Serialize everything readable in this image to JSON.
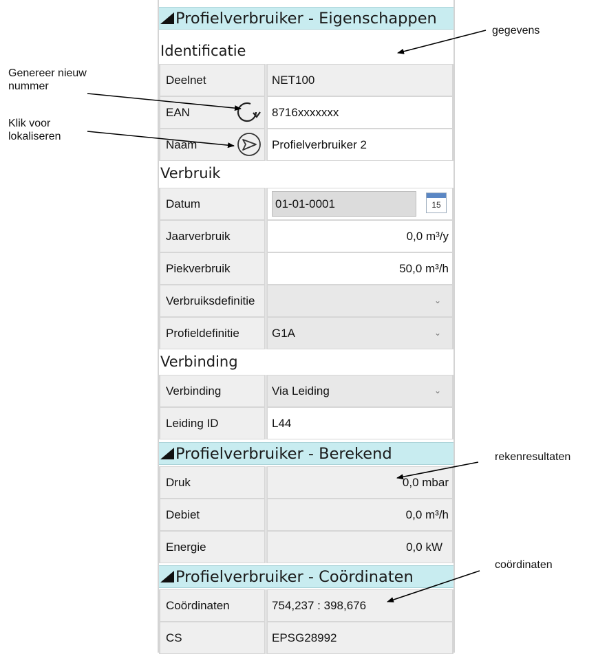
{
  "sections": {
    "eigenschappen": "Profielverbruiker - Eigenschappen",
    "berekend": "Profielverbruiker - Berekend",
    "coordinaten": "Profielverbruiker - Coördinaten"
  },
  "groups": {
    "identificatie": "Identificatie",
    "verbruik": "Verbruik",
    "verbinding": "Verbinding"
  },
  "identificatie": {
    "deelnet": {
      "label": "Deelnet",
      "value": "NET100"
    },
    "ean": {
      "label": "EAN",
      "value": "8716xxxxxxx"
    },
    "naam": {
      "label": "Naam",
      "value": "Profielverbruiker 2"
    }
  },
  "verbruik": {
    "datum": {
      "label": "Datum",
      "value": "01-01-0001",
      "calendar_day": "15"
    },
    "jaarverbruik": {
      "label": "Jaarverbruik",
      "value": "0,0 m³/y"
    },
    "piekverbruik": {
      "label": "Piekverbruik",
      "value": "50,0 m³/h"
    },
    "verbruiksdefinitie": {
      "label": "Verbruiksdefinitie",
      "value": ""
    },
    "profieldefinitie": {
      "label": "Profieldefinitie",
      "value": "G1A"
    }
  },
  "verbinding": {
    "verbinding": {
      "label": "Verbinding",
      "value": "Via Leiding"
    },
    "leiding_id": {
      "label": "Leiding ID",
      "value": "L44"
    }
  },
  "berekend": {
    "druk": {
      "label": "Druk",
      "value": "0,0 mbar"
    },
    "debiet": {
      "label": "Debiet",
      "value": "0,0 m³/h"
    },
    "energie": {
      "label": "Energie",
      "value": "0,0 kW"
    }
  },
  "coordinaten": {
    "coordinaten": {
      "label": "Coördinaten",
      "value": "754,237 : 398,676"
    },
    "cs": {
      "label": "CS",
      "value": "EPSG28992"
    }
  },
  "annotations": {
    "gegevens": "gegevens",
    "genereer_line1": "Genereer nieuw",
    "genereer_line2": "nummer",
    "klik_line1": "Klik voor",
    "klik_line2": "lokaliseren",
    "rekenresultaten": "rekenresultaten",
    "coordinaten": "coördinaten"
  },
  "icons": {
    "refresh": "refresh-icon",
    "locate": "locate-icon",
    "calendar": "calendar-icon",
    "collapse": "collapse-triangle-icon",
    "dropdown": "chevron-down-icon"
  },
  "colors": {
    "section_header_bg": "#c8ecf0",
    "label_bg": "#efefef",
    "border": "#d6d6d6"
  }
}
